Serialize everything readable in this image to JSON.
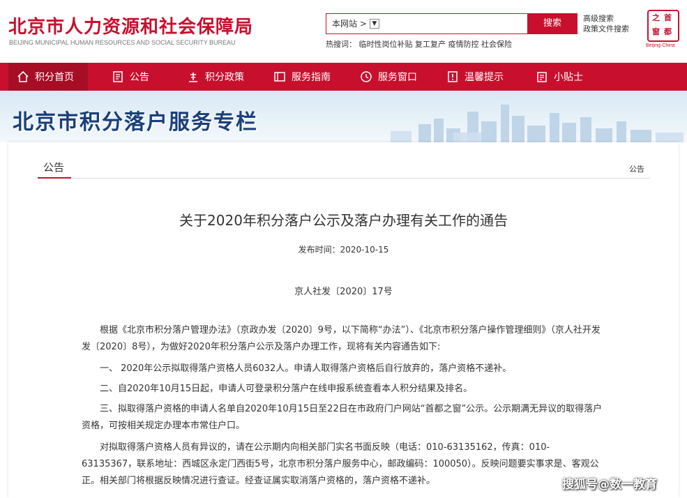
{
  "header": {
    "logo_cn": "北京市人力资源和社会保障局",
    "logo_en": "BEIJING MUNICIPAL HUMAN RESOURCES AND SOCIAL SECURITY BUREAU",
    "search_scope": "本网站 >",
    "search_button": "搜索",
    "advanced_search": "高级搜索",
    "policy_search": "政策文件搜索",
    "hot_label": "热搜词：",
    "hot_words": "临时性岗位补贴 复工复产 疫情防控 社会保险",
    "seal_chars": [
      "首",
      "都",
      "之",
      "窗"
    ],
    "seal_sub": "Beijing·China"
  },
  "nav": {
    "items": [
      {
        "label": "积分首页",
        "icon": "home-icon"
      },
      {
        "label": "公告",
        "icon": "notice-icon"
      },
      {
        "label": "积分政策",
        "icon": "policy-icon"
      },
      {
        "label": "服务指南",
        "icon": "guide-icon"
      },
      {
        "label": "服务窗口",
        "icon": "service-window-icon"
      },
      {
        "label": "温馨提示",
        "icon": "tips-icon"
      },
      {
        "label": "小贴士",
        "icon": "note-icon"
      }
    ]
  },
  "banner": {
    "title": "北京市积分落户服务专栏"
  },
  "content": {
    "tab": "公告",
    "breadcrumb": "公告",
    "title": "关于2020年积分落户公示及落户办理有关工作的通告",
    "date": "发布时间：2020-10-15",
    "doc_no": "京人社发〔2020〕17号",
    "paragraphs": [
      "根据《北京市积分落户管理办法》（京政办发〔2020〕9号，以下简称“办法”）、《北京市积分落户操作管理细则》（京人社开发发〔2020〕8号），为做好2020年积分落户公示及落户办理工作，现将有关内容通告如下:",
      "一、 2020年公示拟取得落户资格人员6032人。申请人取得落户资格后自行放弃的，落户资格不递补。",
      "二、自2020年10月15日起，申请人可登录积分落户在线申报系统查看本人积分结果及排名。",
      "三、拟取得落户资格的申请人名单自2020年10月15日至22日在市政府门户网站“首都之窗”公示。公示期满无异议的取得落户资格，可按相关规定办理本市常住户口。",
      "对拟取得落户资格人员有异议的，请在公示期内向相关部门实名书面反映（电话：010-63135162，传真：010-63135367，联系地址：西城区永定门西街5号，北京市积分落户服务中心，邮政编码：100050）。反映问题要实事求是、客观公正。相关部门将根据反映情况进行查证。经查证属实取消落户资格的，落户资格不递补。"
    ]
  },
  "watermark": "搜狐号@数一教育",
  "colors": {
    "brand": "#c8102e",
    "banner_title": "#1a3f7a"
  }
}
